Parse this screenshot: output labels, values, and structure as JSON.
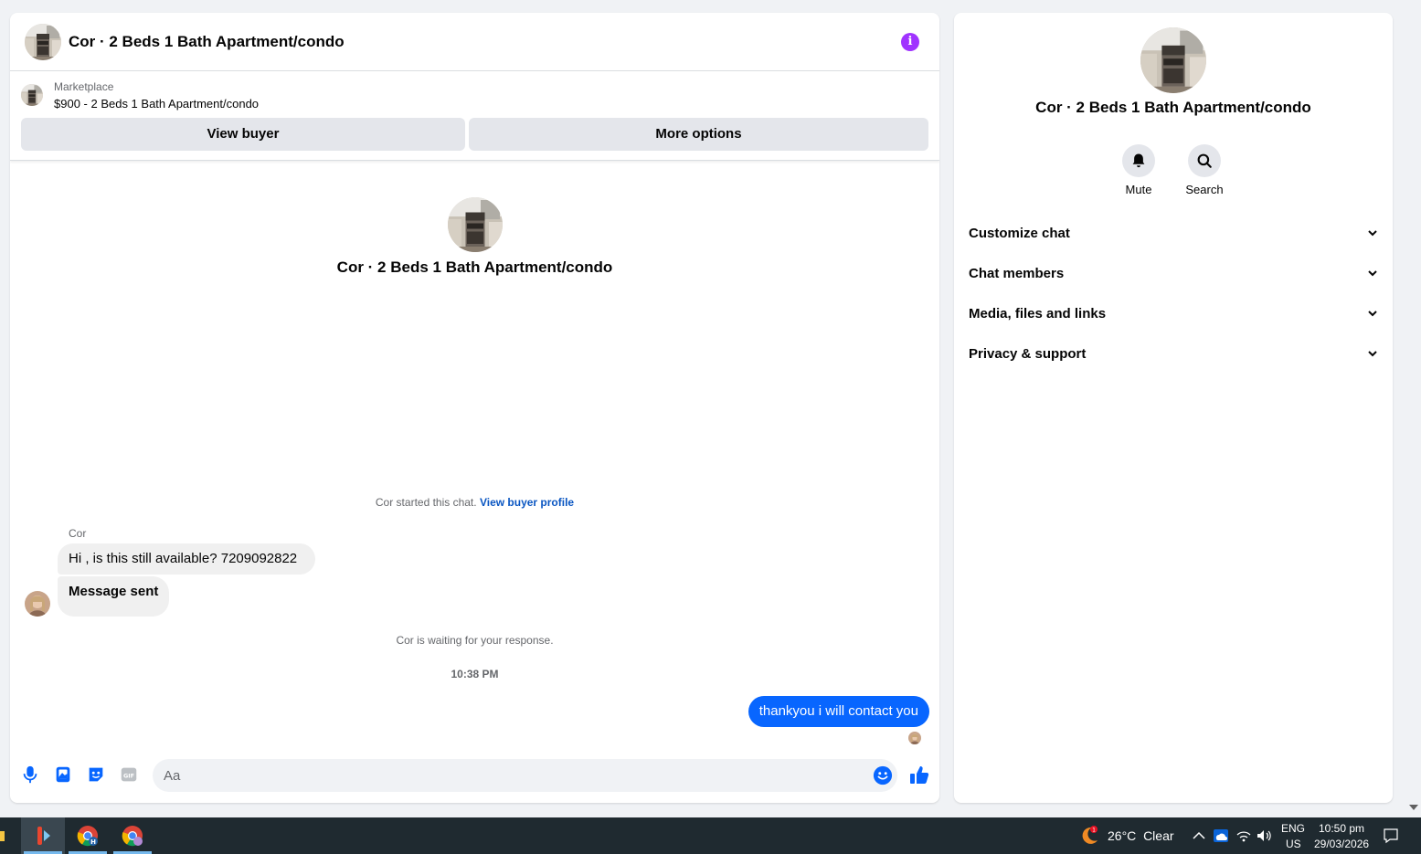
{
  "chat": {
    "title": "Cor · 2 Beds 1 Bath Apartment/condo",
    "marketplace_label": "Marketplace",
    "listing_price_title": "$900 - 2 Beds 1 Bath Apartment/condo",
    "view_buyer_label": "View buyer",
    "more_options_label": "More options",
    "intro_title": "Cor · 2 Beds 1 Bath Apartment/condo",
    "started_text": "Cor started this chat.",
    "view_buyer_profile_label": "View buyer profile",
    "sender_name": "Cor",
    "messages_in": [
      "Hi , is this still available?  7209092822",
      "Message sent"
    ],
    "waiting_text": "Cor is waiting for your response.",
    "timestamp": "10:38 PM",
    "message_out": "thankyou i will contact you",
    "input_placeholder": "Aa"
  },
  "info_panel": {
    "title": "Cor · 2 Beds 1 Bath Apartment/condo",
    "mute_label": "Mute",
    "search_label": "Search",
    "sections": [
      "Customize chat",
      "Chat members",
      "Media, files and links",
      "Privacy & support"
    ]
  },
  "taskbar": {
    "weather_temp": "26°C",
    "weather_cond": "Clear",
    "lang_top": "ENG",
    "lang_bottom": "US",
    "time": "10:50 pm",
    "date": "29/03/2026",
    "notif_count": "1"
  },
  "colors": {
    "accent_blue": "#0866ff",
    "info_purple": "#a033ff",
    "taskbar_bg": "#1f2a30"
  },
  "icons": [
    "info-icon",
    "mic-icon",
    "photo-icon",
    "sticker-icon",
    "gif-icon",
    "emoji-icon",
    "thumbs-up-icon",
    "bell-icon",
    "search-icon",
    "chevron-down-icon",
    "windows-start-icon",
    "chrome-icon",
    "weather-moon-icon",
    "network-icon",
    "volume-icon",
    "notification-icon"
  ]
}
